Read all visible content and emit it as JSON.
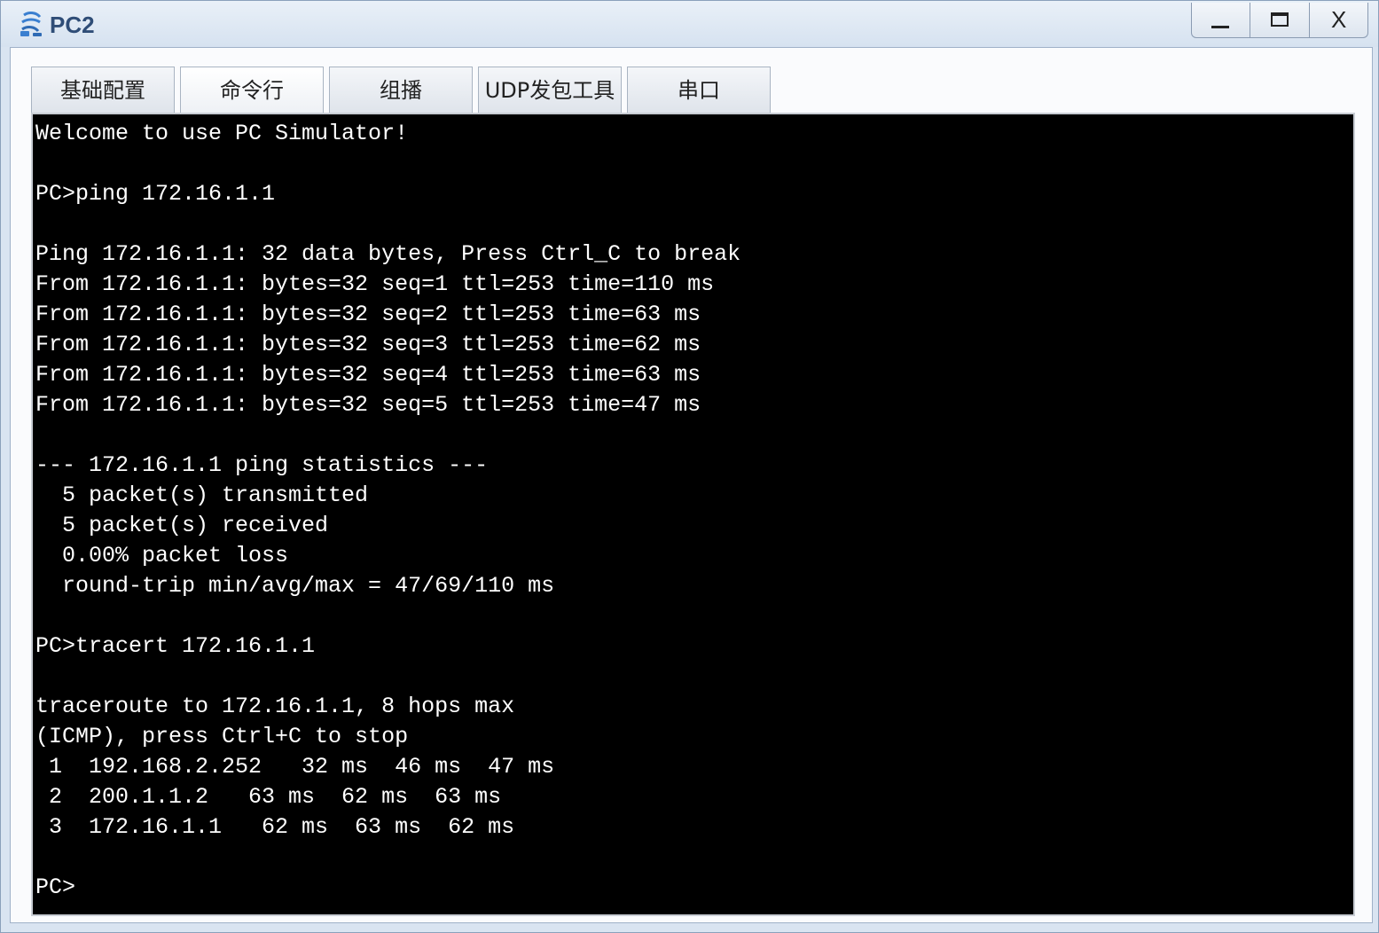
{
  "window": {
    "title": "PC2",
    "icon": "app-network-icon",
    "controls": {
      "minimize": "minimize-icon",
      "maximize": "maximize-icon",
      "close_label": "X"
    }
  },
  "tabs": [
    {
      "label": "基础配置",
      "active": false
    },
    {
      "label": "命令行",
      "active": true
    },
    {
      "label": "组播",
      "active": false
    },
    {
      "label": "UDP发包工具",
      "active": false
    },
    {
      "label": "串口",
      "active": false
    }
  ],
  "terminal": {
    "lines": [
      "Welcome to use PC Simulator!",
      "",
      "PC>ping 172.16.1.1",
      "",
      "Ping 172.16.1.1: 32 data bytes, Press Ctrl_C to break",
      "From 172.16.1.1: bytes=32 seq=1 ttl=253 time=110 ms",
      "From 172.16.1.1: bytes=32 seq=2 ttl=253 time=63 ms",
      "From 172.16.1.1: bytes=32 seq=3 ttl=253 time=62 ms",
      "From 172.16.1.1: bytes=32 seq=4 ttl=253 time=63 ms",
      "From 172.16.1.1: bytes=32 seq=5 ttl=253 time=47 ms",
      "",
      "--- 172.16.1.1 ping statistics ---",
      "  5 packet(s) transmitted",
      "  5 packet(s) received",
      "  0.00% packet loss",
      "  round-trip min/avg/max = 47/69/110 ms",
      "",
      "PC>tracert 172.16.1.1",
      "",
      "traceroute to 172.16.1.1, 8 hops max",
      "(ICMP), press Ctrl+C to stop",
      " 1  192.168.2.252   32 ms  46 ms  47 ms",
      " 2  200.1.1.2   63 ms  62 ms  63 ms",
      " 3  172.16.1.1   62 ms  63 ms  62 ms",
      "",
      "PC>"
    ]
  }
}
